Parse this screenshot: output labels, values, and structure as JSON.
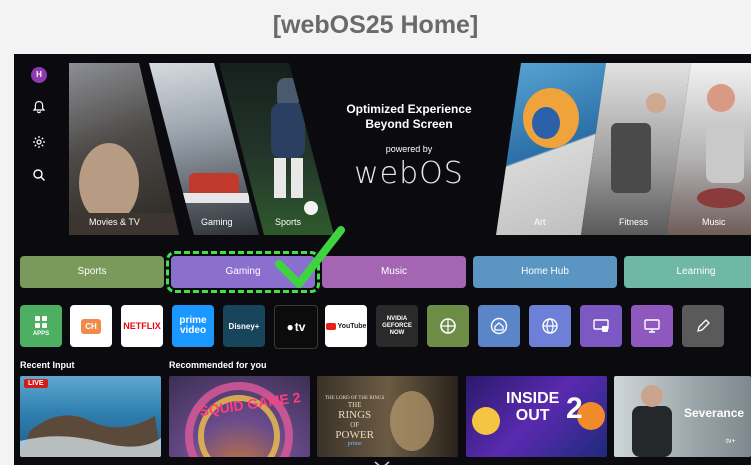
{
  "page_title": "[webOS25 Home]",
  "rail": {
    "avatar_letter": "H",
    "icons": [
      "bell-icon",
      "gear-icon",
      "search-icon"
    ]
  },
  "hero_left": {
    "cards": [
      {
        "label": "Movies & TV"
      },
      {
        "label": "Gaming"
      },
      {
        "label": "Sports"
      }
    ]
  },
  "hero_center": {
    "line1": "Optimized Experience",
    "line2": "Beyond Screen",
    "powered": "powered by",
    "logo": "webOS"
  },
  "hero_right": {
    "cards": [
      {
        "label": "Art"
      },
      {
        "label": "Fitness"
      },
      {
        "label": "Music"
      }
    ]
  },
  "categories": [
    {
      "label": "Sports",
      "color": "#7a9a5c"
    },
    {
      "label": "Gaming",
      "color": "#8a6fcf",
      "selected": true
    },
    {
      "label": "Music",
      "color": "#a466b3"
    },
    {
      "label": "Home Hub",
      "color": "#5b95c2"
    },
    {
      "label": "Learning",
      "color": "#6fb7a6"
    }
  ],
  "apps": {
    "apps_label": "APPS",
    "ch_label": "CH",
    "netflix": "NETFLIX",
    "prime_1": "prime",
    "prime_2": "video",
    "disney": "Disney+",
    "appletv": "tv",
    "youtube": "YouTube",
    "geforce_1": "NVIDIA",
    "geforce_2": "GEFORCE",
    "geforce_3": "NOW"
  },
  "sections": {
    "recent": "Recent Input",
    "recommended": "Recommended for you"
  },
  "tiles": {
    "live": "LIVE",
    "squid": "SQUID GAME 2",
    "rings_top": "THE LORD OF THE RINGS",
    "rings_1": "THE",
    "rings_2": "RINGS",
    "rings_3": "OF",
    "rings_4": "POWER",
    "prime": "prime",
    "inside_1": "INSIDE",
    "inside_2": "OUT",
    "inside_3": "2",
    "severance": "Severance",
    "appletv_small": "tv+"
  }
}
